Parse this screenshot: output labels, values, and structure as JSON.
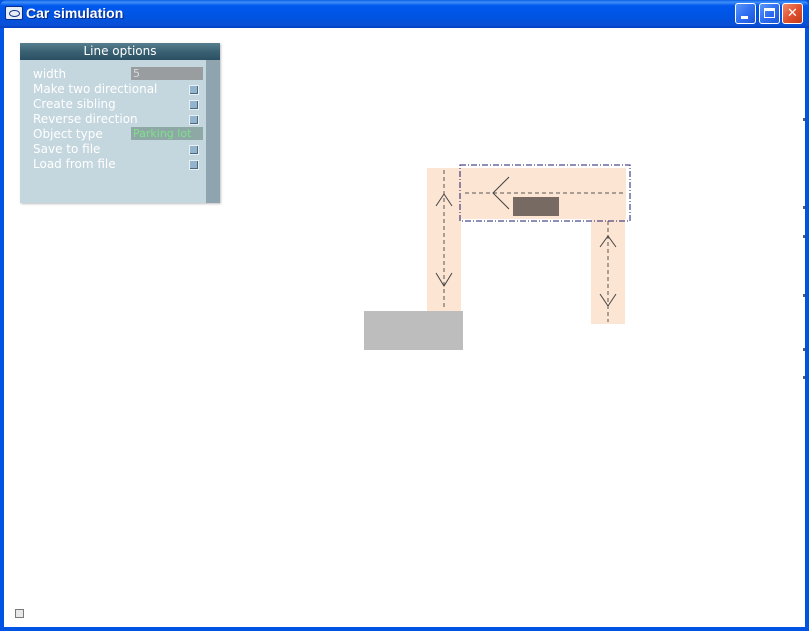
{
  "window": {
    "title": "Car simulation",
    "minimize_label": "",
    "maximize_label": "",
    "close_label": "✕"
  },
  "line_options": {
    "title": "Line options",
    "width_label": "width",
    "width_value": "5",
    "make_two_directional_label": "Make two directional",
    "create_sibling_label": "Create sibling",
    "reverse_direction_label": "Reverse direction",
    "object_type_label": "Object type",
    "object_type_value": "Parking lot",
    "save_to_file_label": "Save to file",
    "load_from_file_label": "Load from file"
  },
  "scene": {
    "road_color": "#fde5d3",
    "parked_car_color": "#766a62",
    "building_color": "#bdbdbd",
    "selection_color": "#1e1e6e",
    "direction_arrows": [
      "up",
      "down",
      "left",
      "up",
      "down"
    ]
  }
}
